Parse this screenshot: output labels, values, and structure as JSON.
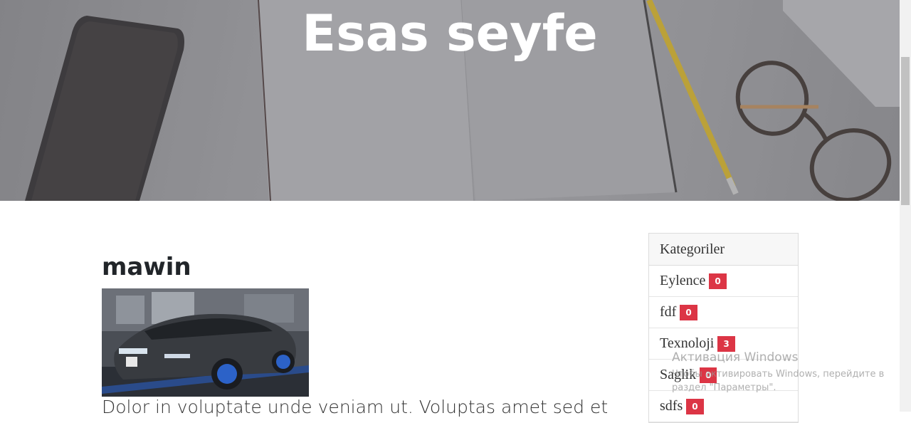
{
  "hero": {
    "title": "Esas seyfe"
  },
  "post": {
    "title": "mawin",
    "excerpt": "Dolor in voluptate unde veniam ut. Voluptas amet sed et"
  },
  "sidebar": {
    "header": "Kategoriler",
    "categories": [
      {
        "name": "Eylence",
        "count": "0"
      },
      {
        "name": "fdf",
        "count": "0"
      },
      {
        "name": "Texnoloji",
        "count": "3"
      },
      {
        "name": "Saglik",
        "count": "0"
      },
      {
        "name": "sdfs",
        "count": "0"
      }
    ]
  },
  "watermark": {
    "title": "Активация Windows",
    "line1": "Чтобы активировать Windows, перейдите в",
    "line2": "раздел \"Параметры\"."
  },
  "colors": {
    "badge": "#dc3545",
    "hero_bg": "#9d9da1"
  }
}
